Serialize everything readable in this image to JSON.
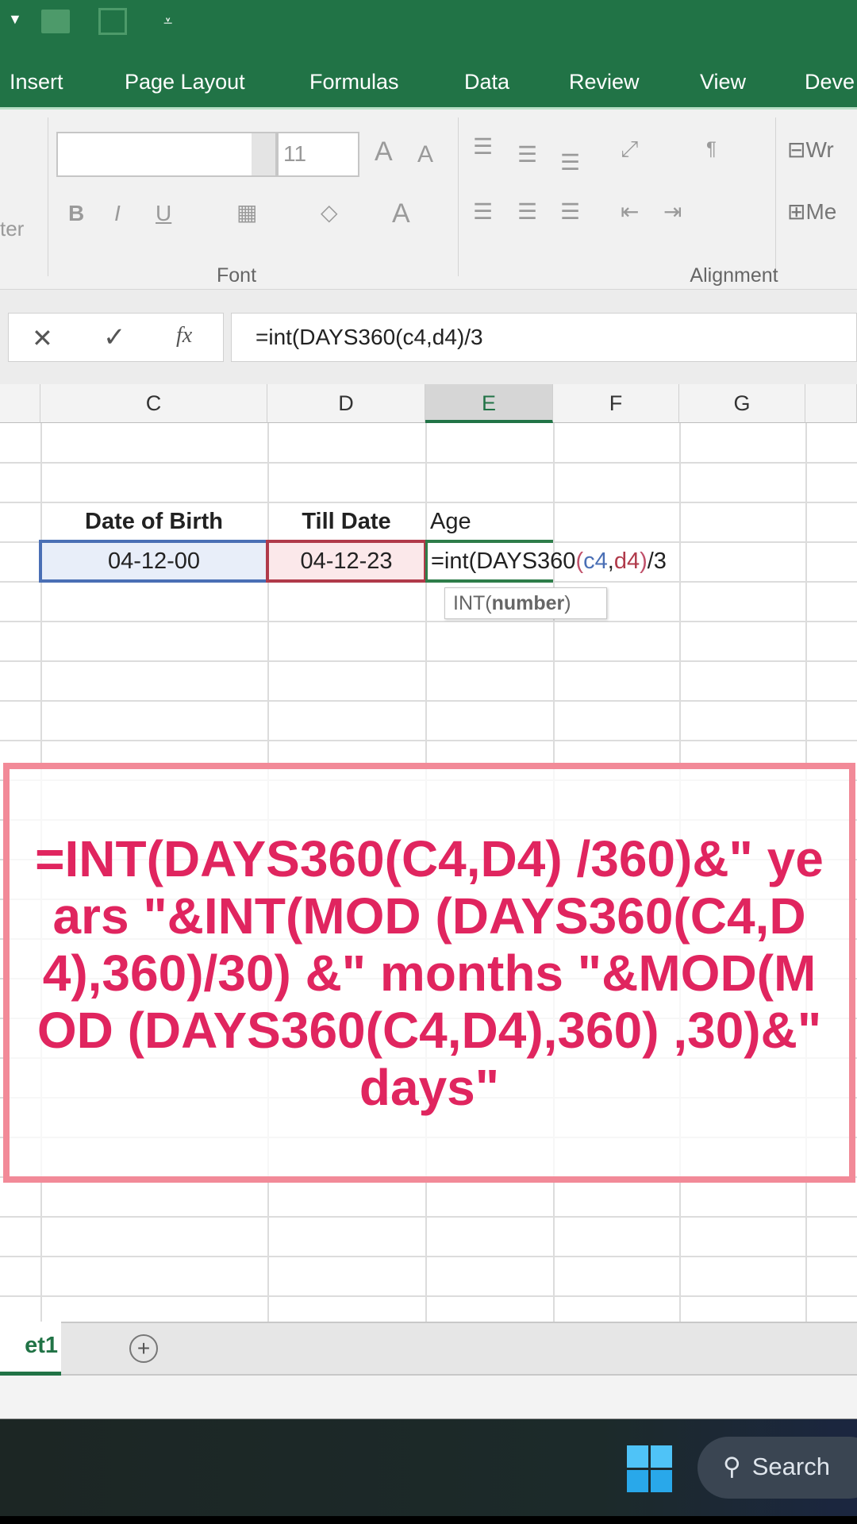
{
  "ribbon": {
    "tabs": [
      "Insert",
      "Page Layout",
      "Formulas",
      "Data",
      "Review",
      "View",
      "Deve"
    ],
    "font_size": "11",
    "group_font": "Font",
    "group_alignment": "Alignment",
    "clip_partial": "ter",
    "wrap_partial": "Wr",
    "merge_partial": "Me",
    "bold": "B",
    "italic": "I",
    "underline": "U",
    "grow": "A",
    "shrink": "A",
    "fontcolor": "A"
  },
  "formula_bar": {
    "cancel": "✕",
    "enter": "✓",
    "fx": "fx",
    "value": "=int(DAYS360(c4,d4)/3"
  },
  "columns": [
    "C",
    "D",
    "E",
    "F",
    "G"
  ],
  "cells": {
    "c3": "Date of Birth",
    "d3": "Till Date",
    "e3": "Age",
    "c4": "04-12-00",
    "d4": "04-12-23",
    "e4_parts": {
      "p1": "=int(DAYS360",
      "p2": "(",
      "p3": "c4",
      "p4": ",",
      "p5": "d4",
      "p6": ")",
      "p7": "/3"
    }
  },
  "tooltip": {
    "fn": "INT(",
    "arg": "number",
    ")": ")"
  },
  "overlay": {
    "text": "=INT(DAYS360(C4,D4) /360)&\" years \"&INT(MOD (DAYS360(C4,D4),360)/30) &\" months \"&MOD(MOD (DAYS360(C4,D4),360) ,30)&\" days\""
  },
  "sheets": {
    "active": "et1",
    "add": "+"
  },
  "taskbar": {
    "search": "Search"
  },
  "colors": {
    "excel_green": "#217346",
    "overlay_text": "#e0255f",
    "overlay_border": "#f28a98"
  }
}
